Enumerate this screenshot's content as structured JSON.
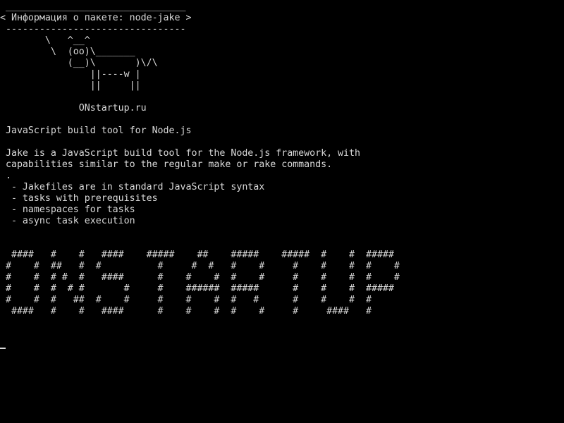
{
  "terminal": {
    "screen_text": " ________________________________\n< Информация о пакете: node-jake >\n --------------------------------\n        \\   ^__^\n         \\  (oo)\\_______\n            (__)\\       )\\/\\\n                ||----w |\n                ||     ||\n\n              ONstartup.ru\n\n JavaScript build tool for Node.js\n\n Jake is a JavaScript build tool for the Node.js framework, with\n capabilities similar to the regular make or rake commands.\n .\n  - Jakefiles are in standard JavaScript syntax\n  - tasks with prerequisites\n  - namespaces for tasks\n  - async task execution\n\n\n  ####   #    #   ####    #####    ##    #####    #####  #    #  #####\n #    #  ##   #  #          #     #  #   #    #     #    #    #  #    #\n #    #  # #  #   ####      #    #    #  #    #     #    #    #  #    #\n #    #  #  # #       #     #    ######  #####      #    #    #  #####\n #    #  #   ##  #    #     #    #    #  #   #      #    #    #  #\n  ####   #    #   ####      #    #    #  #    #     #     ####   #\n"
  },
  "colors": {
    "background": "#000000",
    "foreground": "#d8d8d8"
  }
}
